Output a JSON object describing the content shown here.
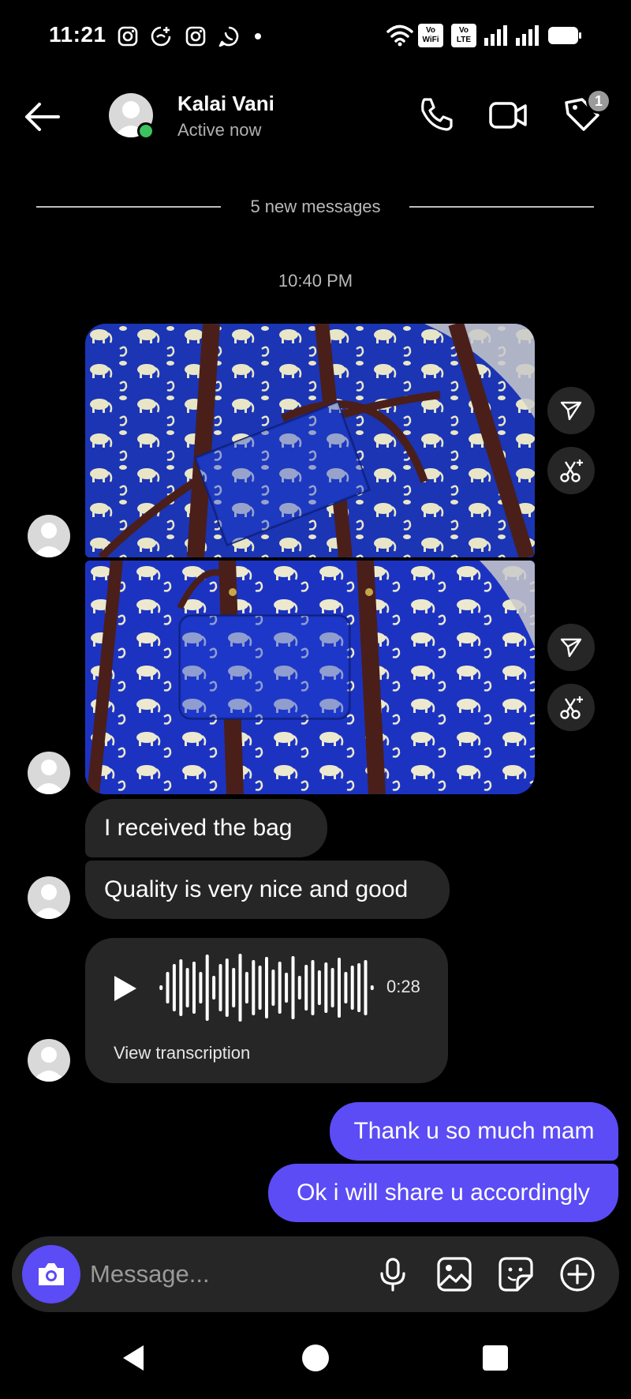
{
  "status_bar": {
    "time": "11:21",
    "icons": [
      "instagram-icon",
      "threads-icon",
      "instagram-icon",
      "whatsapp-icon",
      "notification-dot"
    ],
    "right_icons": [
      "wifi-icon",
      "vowifi-badge",
      "volte-badge",
      "signal-icon",
      "signal-icon",
      "battery-icon"
    ],
    "vowifi_label": "Vo WiFi",
    "vowifi_num": "2",
    "volte_label": "Vo LTE",
    "volte_num": "1"
  },
  "header": {
    "contact_name": "Kalai Vani",
    "contact_status": "Active now",
    "tag_badge_count": "1",
    "online_color": "#3ac35f"
  },
  "conversation": {
    "new_messages_label": "5 new messages",
    "timestamp": "10:40 PM",
    "incoming": [
      {
        "type": "photo",
        "alt": "blue elephant print bag with pouch"
      },
      {
        "type": "photo",
        "alt": "blue elephant print bag with pouch"
      },
      {
        "type": "text",
        "text": "I received the bag"
      },
      {
        "type": "text",
        "text": "Quality is very nice and good"
      },
      {
        "type": "voice",
        "duration": "0:28",
        "transcription_label": "View transcription"
      }
    ],
    "outgoing": [
      {
        "type": "text",
        "text": "Thank u so much mam"
      },
      {
        "type": "text",
        "text": "Ok i will share u accordingly"
      }
    ]
  },
  "composer": {
    "placeholder": "Message...",
    "accent_color": "#5b4cf5"
  },
  "colors": {
    "background": "#000000",
    "bubble_in": "#262626",
    "bubble_out": "#5b4cf5"
  }
}
